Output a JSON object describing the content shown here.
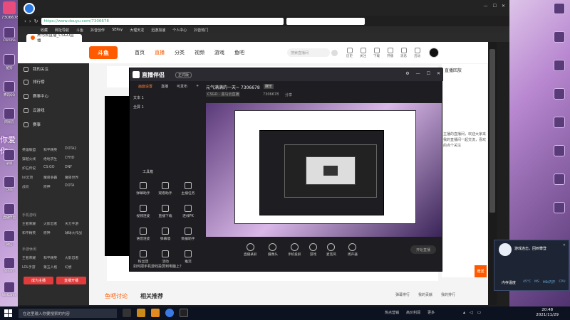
{
  "desktop": {
    "top_number": "7306678",
    "overlay_text": "你爱你",
    "icons": [
      "Chrome",
      "酷狗",
      "腾讯QQ",
      "网易云",
      "录屏",
      "OBS",
      "直播伴侣",
      "微信",
      "Steam",
      "WeGame",
      "CSGO",
      "哔哩哔哩"
    ]
  },
  "browser": {
    "url": "https://www.douyu.com/7306678",
    "bookmarks": [
      "收藏",
      "网址导航",
      "斗鱼",
      "抖音创作",
      "SEPay",
      "大理天龙",
      "迅游加速",
      "个人中心",
      "抖音热门"
    ],
    "tab_title": "黑马云直播_CSGO直播",
    "scroll_hint": ""
  },
  "site": {
    "logo": "斗鱼",
    "nav": [
      "首页",
      "直播",
      "分类",
      "视频",
      "游戏",
      "鱼吧"
    ],
    "search_placeholder": "搜索直播间",
    "header_icons": [
      "历史",
      "关注",
      "下载",
      "开播",
      "消息",
      "活动"
    ],
    "sidebar": {
      "items": [
        "我的关注",
        "排行榜",
        "赛事中心",
        "云游戏",
        "赛事"
      ],
      "grid": [
        "英雄联盟",
        "和平精英",
        "DOTA2",
        "穿越火线",
        "绝地求生",
        "CFHD",
        "炉石传说",
        "CS:GO",
        "DNF",
        "lol云顶",
        "魔兽争霸",
        "魔兽世界",
        "战双",
        "原神",
        "DOTA",
        "魔兽世界",
        "魔兽争霸",
        "APEX英雄"
      ],
      "section_mobile": "手机游戏",
      "mobile_grid": [
        "王者荣耀",
        "火影忍者",
        "天刀手游",
        "和平精英",
        "原神",
        "球球大作战",
        "明日方舟",
        "音乐",
        "王者模拟"
      ],
      "section_fun": "手游休闲",
      "fun_grid": [
        "王者荣耀",
        "和平精英",
        "火影忍者",
        "LOL手游",
        "第五人格",
        "幻想"
      ],
      "btn_left": "成为主播",
      "btn_right": "直播开播"
    },
    "right_col": {
      "title": "直播回放",
      "text": "主播的直播间，欢迎大家来我的直播间一起交流，喜欢的点个关注",
      "btn": "赠送",
      "bottom_labels": [
        "弹幕排行",
        "我的贡献",
        "我的排行"
      ]
    },
    "bottom": {
      "left": "鱼吧讨论",
      "title": "相关推荐"
    }
  },
  "helper": {
    "title": "直播伴侣",
    "version": "正式版",
    "tabs": [
      "画面设置",
      "直播",
      "可发布"
    ],
    "layers": [
      "文本 1",
      "全屏 1"
    ],
    "room_title": "元气满满的一天~ 7306678",
    "room_tag": "娱乐",
    "category": "CSGO - 黑马云直播",
    "room_id": "7306678",
    "share": "分享",
    "toolbox_label": "工具箱",
    "tools": [
      "弹幕助手",
      "观看助手",
      "主播任务",
      "视频连麦",
      "直播下载",
      "连线PK",
      "语音连麦",
      "弹幕墙",
      "数据助手",
      "粉丝团",
      "活动",
      "推流"
    ],
    "bottom_tools": [
      "直播录屏",
      "摄像头",
      "手机投屏",
      "游戏",
      "麦克风",
      "扬声器"
    ],
    "live_btn": "开始直播",
    "notice": "如何把手机游戏投屏到电脑上？"
  },
  "notification": {
    "title": "游戏连击，回到攀登",
    "line": "内存温度",
    "stats": [
      "45°C",
      "MS",
      "MB/内存",
      "CPU"
    ]
  },
  "taskbar": {
    "search": "在这里输入你要搜索的内容",
    "time": "20:48",
    "date": "2021/11/29",
    "tray": [
      "热点营销",
      "高价利润",
      "更多"
    ]
  },
  "colors": {
    "accent": "#ff5a00",
    "sidebar": "#2c2c2c",
    "helper": "#1e1e22"
  }
}
